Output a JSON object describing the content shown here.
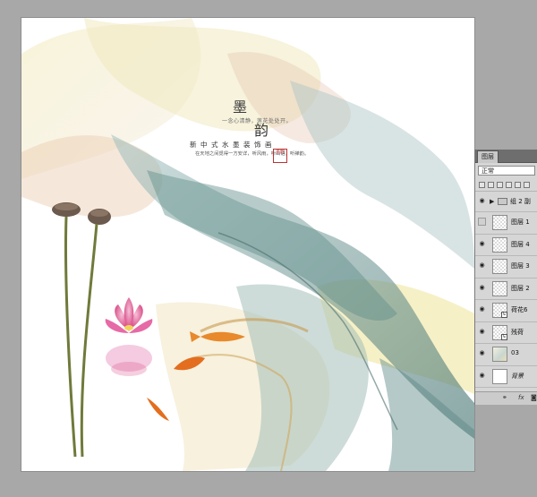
{
  "artwork": {
    "title_char_1": "墨",
    "title_char_2": "韵",
    "tagline": "一念心清静，莲花处处开。",
    "subtitle": "新中式水墨装饰画",
    "small_line": "在天地之间觅得一方安详，听风雨，听山语，听禅韵。",
    "seal_text": "墨韵"
  },
  "layers_panel": {
    "tab_label": "图层",
    "blend_mode": "正常",
    "group_name": "组 2 副",
    "layers": [
      {
        "name": "图层 1",
        "visible": false,
        "thumb": "transparent",
        "linked": false
      },
      {
        "name": "图层 4",
        "visible": true,
        "thumb": "transparent",
        "linked": false
      },
      {
        "name": "图层 3",
        "visible": true,
        "thumb": "transparent",
        "linked": false
      },
      {
        "name": "图层 2",
        "visible": true,
        "thumb": "transparent",
        "linked": false
      },
      {
        "name": "荷花6",
        "visible": true,
        "thumb": "transparent",
        "linked": true
      },
      {
        "name": "残荷",
        "visible": true,
        "thumb": "transparent",
        "linked": true
      },
      {
        "name": "03",
        "visible": true,
        "thumb": "art",
        "linked": false
      },
      {
        "name": "背景",
        "visible": true,
        "thumb": "white",
        "linked": false
      }
    ],
    "footer_fx": "fx"
  },
  "colors": {
    "workspace": "#a8a8a8",
    "panel": "#d6d6d6",
    "teal_ink": "#4f7f7c",
    "yellow_ink": "#e6d98a",
    "lotus_pink": "#e0559a"
  }
}
